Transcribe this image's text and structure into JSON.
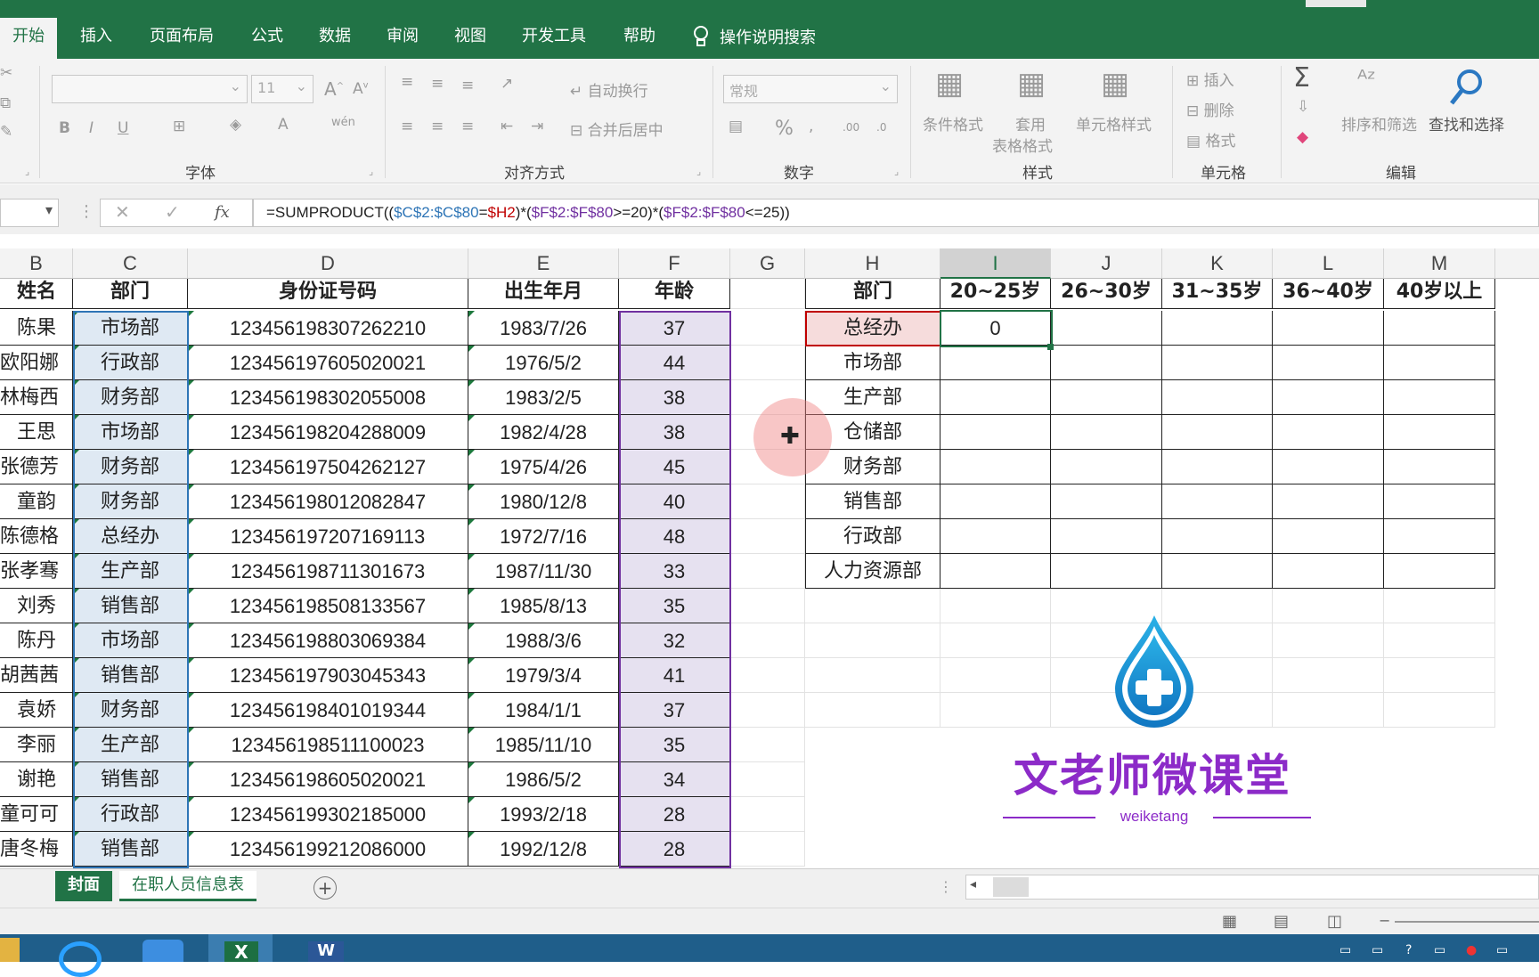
{
  "ribbon_tabs": [
    "开始",
    "插入",
    "页面布局",
    "公式",
    "数据",
    "审阅",
    "视图",
    "开发工具",
    "帮助"
  ],
  "tell_me": "操作说明搜索",
  "ribbon": {
    "font_size": "11",
    "bold": "B",
    "italic": "I",
    "underline": "U",
    "font_group": "字体",
    "wrap_text": "自动换行",
    "merge_center": "合并后居中",
    "align_group": "对齐方式",
    "number_format": "常规",
    "number_group": "数字",
    "percent": "%",
    "cond_format": "条件格式",
    "table_format_1": "套用",
    "table_format_2": "表格格式",
    "cell_style": "单元格样式",
    "styles_group": "样式",
    "insert": "插入",
    "delete": "删除",
    "format": "格式",
    "cells_group": "单元格",
    "sort_filter": "排序和筛选",
    "find_select": "查找和选择",
    "edit_group": "编辑"
  },
  "formula_bar": {
    "fx": "fx",
    "formula": "=SUMPRODUCT(($C$2:$C$80=$H2)*($F$2:$F$80>=20)*($F$2:$F$80<=25))"
  },
  "columns": [
    "B",
    "C",
    "D",
    "E",
    "F",
    "G",
    "H",
    "I",
    "J",
    "K",
    "L",
    "M"
  ],
  "table_headers": [
    "姓名",
    "部门",
    "身份证号码",
    "出生年月",
    "年龄"
  ],
  "rows": [
    [
      "陈果",
      "市场部",
      "123456198307262210",
      "1983/7/26",
      "37"
    ],
    [
      "欧阳娜",
      "行政部",
      "123456197605020021",
      "1976/5/2",
      "44"
    ],
    [
      "林梅西",
      "财务部",
      "123456198302055008",
      "1983/2/5",
      "38"
    ],
    [
      "王思",
      "市场部",
      "123456198204288009",
      "1982/4/28",
      "38"
    ],
    [
      "张德芳",
      "财务部",
      "123456197504262127",
      "1975/4/26",
      "45"
    ],
    [
      "童韵",
      "财务部",
      "123456198012082847",
      "1980/12/8",
      "40"
    ],
    [
      "陈德格",
      "总经办",
      "123456197207169113",
      "1972/7/16",
      "48"
    ],
    [
      "张孝骞",
      "生产部",
      "123456198711301673",
      "1987/11/30",
      "33"
    ],
    [
      "刘秀",
      "销售部",
      "123456198508133567",
      "1985/8/13",
      "35"
    ],
    [
      "陈丹",
      "市场部",
      "123456198803069384",
      "1988/3/6",
      "32"
    ],
    [
      "胡茜茜",
      "销售部",
      "123456197903045343",
      "1979/3/4",
      "41"
    ],
    [
      "袁娇",
      "财务部",
      "123456198401019344",
      "1984/1/1",
      "37"
    ],
    [
      "李丽",
      "生产部",
      "123456198511100023",
      "1985/11/10",
      "35"
    ],
    [
      "谢艳",
      "销售部",
      "123456198605020021",
      "1986/5/2",
      "34"
    ],
    [
      "童可可",
      "行政部",
      "123456199302185000",
      "1993/2/18",
      "28"
    ],
    [
      "唐冬梅",
      "销售部",
      "123456199212086000",
      "1992/12/8",
      "28"
    ]
  ],
  "summary": {
    "header": "部门",
    "ranges": [
      "20~25岁",
      "26~30岁",
      "31~35岁",
      "36~40岁",
      "40岁以上"
    ],
    "departments": [
      "总经办",
      "市场部",
      "生产部",
      "仓储部",
      "财务部",
      "销售部",
      "行政部",
      "人力资源部"
    ],
    "first_value": "0"
  },
  "watermark": {
    "title": "文老师微课堂",
    "subtitle": "weiketang"
  },
  "sheet_tabs": [
    "封面",
    "在职人员信息表"
  ],
  "colors": {
    "excel_green": "#217346",
    "ref_c": "#2e75b6",
    "ref_h": "#c00000",
    "ref_f": "#7030a0",
    "watermark_purple": "#8c2bc8",
    "watermark_blue": "#1e9ad6"
  }
}
